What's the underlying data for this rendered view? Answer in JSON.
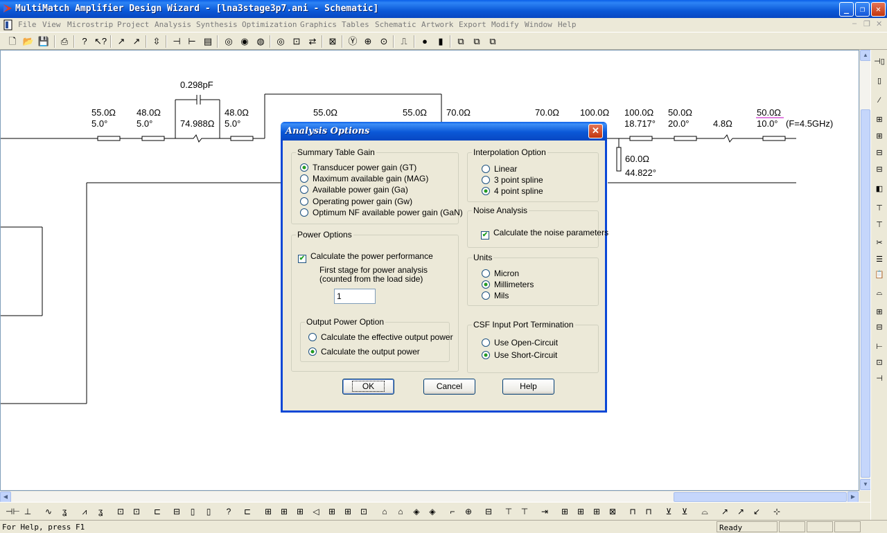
{
  "window": {
    "title": "MultiMatch Amplifier Design Wizard - [lna3stage3p7.ani - Schematic]"
  },
  "menu": [
    "File",
    "View",
    "Microstrip",
    "Project",
    "Analysis",
    "Synthesis",
    "Optimization",
    "Graphics",
    "Tables",
    "Schematic",
    "Artwork",
    "Export",
    "Modify",
    "Window",
    "Help"
  ],
  "toolbar_icons": [
    "new-icon",
    "open-icon",
    "save-icon",
    "print-icon",
    "help-icon",
    "context-help-icon",
    "tune-icon",
    "tune-icon-2",
    "fit-icon",
    "swap-icon",
    "probe-icon",
    "list-icon",
    "circle-icon",
    "circle-icon-2",
    "circle-icon-3",
    "circle-icon-4",
    "box-icon",
    "arrows-icon",
    "cross-icon",
    "y-icon",
    "t-icon",
    "dot-icon",
    "pulse-icon",
    "ring-icon",
    "rect-icon",
    "stack-icon",
    "stack-icon-2",
    "stack-icon-3"
  ],
  "schematic": {
    "labels": [
      {
        "t": "55.0Ω"
      },
      {
        "t": "5.0°"
      },
      {
        "t": "48.0Ω"
      },
      {
        "t": "5.0°"
      },
      {
        "t": "0.298pF"
      },
      {
        "t": "74.988Ω"
      },
      {
        "t": "48.0Ω"
      },
      {
        "t": "5.0°"
      },
      {
        "t": "55.0Ω"
      },
      {
        "t": "55.0Ω"
      },
      {
        "t": "70.0Ω"
      },
      {
        "t": "70.0Ω"
      },
      {
        "t": "100.0Ω"
      },
      {
        "t": "100.0Ω"
      },
      {
        "t": "18.717°"
      },
      {
        "t": "50.0Ω"
      },
      {
        "t": "20.0°"
      },
      {
        "t": "4.8Ω"
      },
      {
        "t": "50.0Ω"
      },
      {
        "t": "10.0°"
      },
      {
        "t": "(F=4.5GHz)"
      },
      {
        "t": "60.0Ω"
      },
      {
        "t": "44.822°"
      }
    ]
  },
  "dialog": {
    "title": "Analysis Options",
    "summary": {
      "legend": "Summary Table Gain",
      "options": [
        {
          "label": "Transducer power gain (GT)",
          "selected": true
        },
        {
          "label": "Maximum available gain (MAG)",
          "selected": false
        },
        {
          "label": "Available power gain (Ga)",
          "selected": false
        },
        {
          "label": "Operating power gain (Gw)",
          "selected": false
        },
        {
          "label": "Optimum NF available power gain (GaN)",
          "selected": false
        }
      ]
    },
    "power": {
      "legend": "Power Options",
      "calc_label": "Calculate the power performance",
      "calc_checked": true,
      "first_stage_line1": "First stage for power analysis",
      "first_stage_line2": "(counted from the load side)",
      "first_stage_value": "1",
      "output": {
        "legend": "Output Power Option",
        "options": [
          {
            "label": "Calculate the effective output power",
            "selected": false
          },
          {
            "label": "Calculate the output power",
            "selected": true
          }
        ]
      }
    },
    "interp": {
      "legend": "Interpolation Option",
      "options": [
        {
          "label": "Linear",
          "selected": false
        },
        {
          "label": "3 point spline",
          "selected": false
        },
        {
          "label": "4 point spline",
          "selected": true
        }
      ]
    },
    "noise": {
      "legend": "Noise Analysis",
      "label": "Calculate the noise parameters",
      "checked": true
    },
    "units": {
      "legend": "Units",
      "options": [
        {
          "label": "Micron",
          "selected": false
        },
        {
          "label": "Millimeters",
          "selected": true
        },
        {
          "label": "Mils",
          "selected": false
        }
      ]
    },
    "csf": {
      "legend": "CSF Input Port Termination",
      "options": [
        {
          "label": "Use Open-Circuit",
          "selected": false
        },
        {
          "label": "Use Short-Circuit",
          "selected": true
        }
      ]
    },
    "buttons": {
      "ok": "OK",
      "cancel": "Cancel",
      "help": "Help"
    }
  },
  "status": {
    "help": "For Help, press F1",
    "ready": "Ready"
  }
}
